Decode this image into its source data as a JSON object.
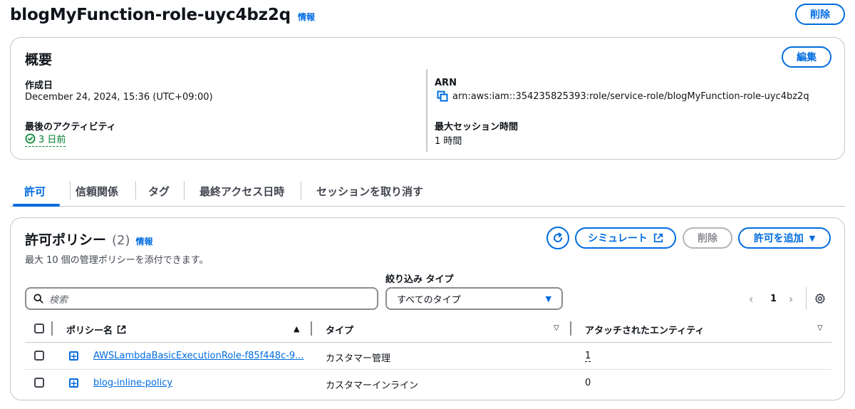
{
  "header": {
    "title": "blogMyFunction-role-uyc4bz2q",
    "info_label": "情報",
    "delete_label": "削除"
  },
  "overview": {
    "title": "概要",
    "edit_label": "編集",
    "created_label": "作成日",
    "created_value": "December 24, 2024, 15:36 (UTC+09:00)",
    "last_activity_label": "最後のアクティビティ",
    "last_activity_value": "3 日前",
    "arn_label": "ARN",
    "arn_value": "arn:aws:iam::354235825393:role/service-role/blogMyFunction-role-uyc4bz2q",
    "max_session_label": "最大セッション時間",
    "max_session_value": "1 時間"
  },
  "tabs": [
    {
      "label": "許可"
    },
    {
      "label": "信頼関係"
    },
    {
      "label": "タグ"
    },
    {
      "label": "最終アクセス日時"
    },
    {
      "label": "セッションを取り消す"
    }
  ],
  "policies": {
    "title": "許可ポリシー",
    "count": "(2)",
    "info_label": "情報",
    "description": "最大 10 個の管理ポリシーを添付できます。",
    "simulate_label": "シミュレート",
    "delete_label": "削除",
    "add_label": "許可を追加",
    "search_placeholder": "検索",
    "filter_label": "絞り込み タイプ",
    "filter_value": "すべてのタイプ",
    "page_number": "1",
    "columns": {
      "name": "ポリシー名",
      "type": "タイプ",
      "entities": "アタッチされたエンティティ"
    },
    "rows": [
      {
        "name": "AWSLambdaBasicExecutionRole-f85f448c-9...",
        "type": "カスタマー管理",
        "entities": "1"
      },
      {
        "name": "blog-inline-policy",
        "type": "カスタマーインライン",
        "entities": "0"
      }
    ]
  },
  "colors": {
    "accent": "#006ce0",
    "success": "#00802f",
    "border": "#c6c6cd"
  }
}
